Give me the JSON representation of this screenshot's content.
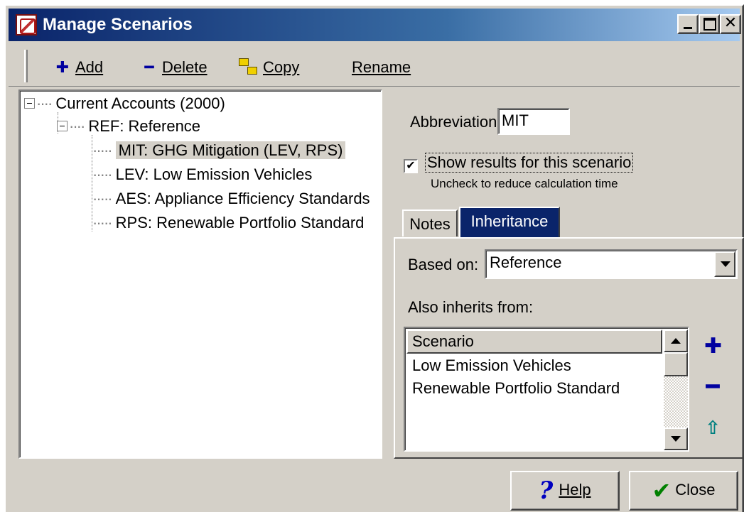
{
  "window": {
    "title": "Manage Scenarios"
  },
  "toolbar": {
    "add_label": "Add",
    "delete_label": "Delete",
    "copy_label": "Copy",
    "rename_label": "Rename"
  },
  "tree": {
    "root": "Current Accounts (2000)",
    "reference": "REF: Reference",
    "children": [
      "MIT: GHG Mitigation (LEV, RPS)",
      "LEV: Low Emission Vehicles",
      "AES: Appliance Efficiency Standards",
      "RPS: Renewable Portfolio Standard"
    ]
  },
  "details": {
    "abbreviation_label": "Abbreviation:",
    "abbreviation_value": "MIT",
    "show_results_label": "Show results for this scenario",
    "show_results_checked": true,
    "show_results_hint": "Uncheck to reduce calculation time"
  },
  "tabs": [
    {
      "label": "Notes",
      "active": false
    },
    {
      "label": "Inheritance",
      "active": true
    }
  ],
  "inheritance": {
    "based_on_label": "Based on:",
    "based_on_value": "Reference",
    "also_inherits_label": "Also inherits from:",
    "list_header": "Scenario",
    "list_items": [
      "Low Emission Vehicles",
      "Renewable Portfolio Standard"
    ]
  },
  "buttons": {
    "help_label": "Help",
    "close_label": "Close"
  },
  "colors": {
    "titlebar_start": "#0a246a",
    "titlebar_end": "#a6caf0",
    "face": "#d4d0c8",
    "active_tab": "#0a246a"
  }
}
